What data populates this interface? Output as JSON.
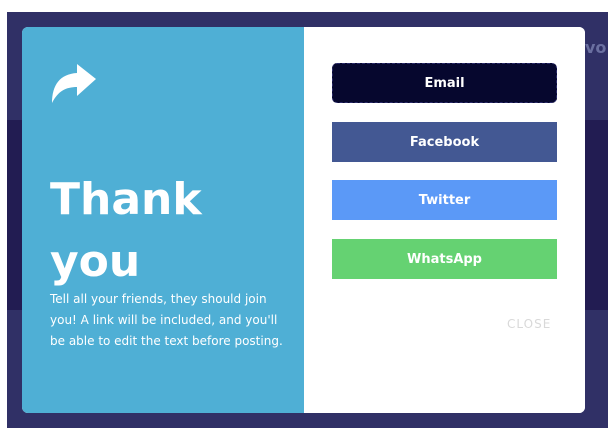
{
  "background": {
    "peek_text": "vo",
    "color": "#303066"
  },
  "modal": {
    "left_panel": {
      "color": "#4fafd5",
      "icon": "share-arrow-icon",
      "title_line1": "Thank",
      "title_line2": "you",
      "message": "Tell all your friends, they should join you! A link will be included, and you'll be able to edit the text before posting."
    },
    "buttons": [
      {
        "label": "Email",
        "color": "#06072e"
      },
      {
        "label": "Facebook",
        "color": "#435893"
      },
      {
        "label": "Twitter",
        "color": "#5b99f7"
      },
      {
        "label": "WhatsApp",
        "color": "#65d272"
      }
    ],
    "close_label": "CLOSE",
    "close_color": "#d9d9d9"
  }
}
